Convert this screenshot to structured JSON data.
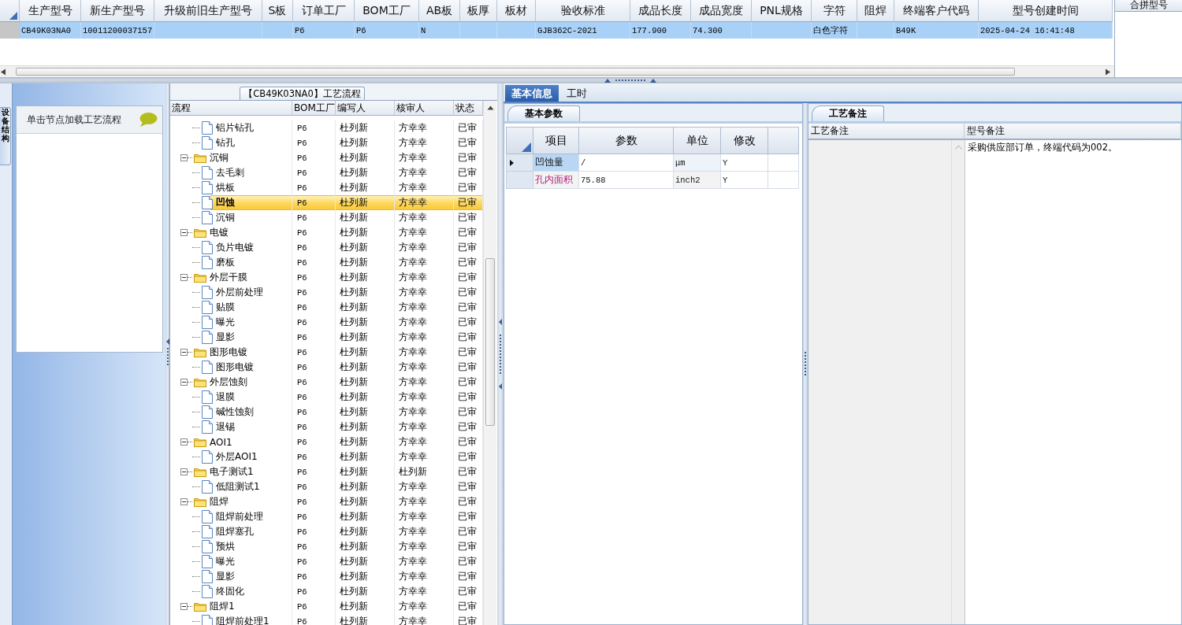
{
  "top_grid": {
    "columns": [
      "生产型号",
      "新生产型号",
      "升级前旧生产型号",
      "S板",
      "订单工厂",
      "BOM工厂",
      "AB板",
      "板厚",
      "板材",
      "验收标准",
      "成品长度",
      "成品宽度",
      "PNL规格",
      "字符",
      "阻焊",
      "终端客户代码",
      "型号创建时间"
    ],
    "rows": [
      {
        "selected": true,
        "cells": [
          "CB49K03NA0",
          "10011200037157",
          null,
          null,
          "P6",
          "P6",
          "N",
          null,
          null,
          "GJB362C-2021",
          "177.900",
          "74.300",
          null,
          "白色字符",
          null,
          "B49K",
          "2025-04-24 16:41:48"
        ]
      }
    ]
  },
  "merge_panel": {
    "title": "合拼型号"
  },
  "side_tab": {
    "label": "设备结构"
  },
  "node_card": {
    "title": "单击节点加载工艺流程"
  },
  "flow_panel": {
    "title": "【CB49K03NA0】工艺流程",
    "columns": [
      "流程",
      "BOM工厂",
      "编写人",
      "核审人",
      "状态"
    ],
    "nodes": [
      {
        "kind": "leaf",
        "name": "铝片钻孔",
        "bom": "P6",
        "writer": "杜列新",
        "reviewer": "方幸幸",
        "status": "已审",
        "selected": false
      },
      {
        "kind": "leaf",
        "name": "钻孔",
        "bom": "P6",
        "writer": "杜列新",
        "reviewer": "方幸幸",
        "status": "已审",
        "selected": false
      },
      {
        "kind": "folder",
        "name": "沉铜",
        "bom": "P6",
        "writer": "杜列新",
        "reviewer": "方幸幸",
        "status": "已审",
        "selected": false,
        "expanded": true,
        "children": [
          {
            "kind": "leaf",
            "name": "去毛刺",
            "bom": "P6",
            "writer": "杜列新",
            "reviewer": "方幸幸",
            "status": "已审",
            "selected": false
          },
          {
            "kind": "leaf",
            "name": "烘板",
            "bom": "P6",
            "writer": "杜列新",
            "reviewer": "方幸幸",
            "status": "已审",
            "selected": false
          },
          {
            "kind": "leaf",
            "name": "凹蚀",
            "bom": "P6",
            "writer": "杜列新",
            "reviewer": "方幸幸",
            "status": "已审",
            "selected": true
          },
          {
            "kind": "leaf",
            "name": "沉铜",
            "bom": "P6",
            "writer": "杜列新",
            "reviewer": "方幸幸",
            "status": "已审",
            "selected": false
          }
        ]
      },
      {
        "kind": "folder",
        "name": "电镀",
        "bom": "P6",
        "writer": "杜列新",
        "reviewer": "方幸幸",
        "status": "已审",
        "selected": false,
        "expanded": true,
        "children": [
          {
            "kind": "leaf",
            "name": "负片电镀",
            "bom": "P6",
            "writer": "杜列新",
            "reviewer": "方幸幸",
            "status": "已审",
            "selected": false
          },
          {
            "kind": "leaf",
            "name": "磨板",
            "bom": "P6",
            "writer": "杜列新",
            "reviewer": "方幸幸",
            "status": "已审",
            "selected": false
          }
        ]
      },
      {
        "kind": "folder",
        "name": "外层干膜",
        "bom": "P6",
        "writer": "杜列新",
        "reviewer": "方幸幸",
        "status": "已审",
        "selected": false,
        "expanded": true,
        "children": [
          {
            "kind": "leaf",
            "name": "外层前处理",
            "bom": "P6",
            "writer": "杜列新",
            "reviewer": "方幸幸",
            "status": "已审",
            "selected": false
          },
          {
            "kind": "leaf",
            "name": "贴膜",
            "bom": "P6",
            "writer": "杜列新",
            "reviewer": "方幸幸",
            "status": "已审",
            "selected": false
          },
          {
            "kind": "leaf",
            "name": "曝光",
            "bom": "P6",
            "writer": "杜列新",
            "reviewer": "方幸幸",
            "status": "已审",
            "selected": false
          },
          {
            "kind": "leaf",
            "name": "显影",
            "bom": "P6",
            "writer": "杜列新",
            "reviewer": "方幸幸",
            "status": "已审",
            "selected": false
          }
        ]
      },
      {
        "kind": "folder",
        "name": "图形电镀",
        "bom": "P6",
        "writer": "杜列新",
        "reviewer": "方幸幸",
        "status": "已审",
        "selected": false,
        "expanded": true,
        "children": [
          {
            "kind": "leaf",
            "name": "图形电镀",
            "bom": "P6",
            "writer": "杜列新",
            "reviewer": "方幸幸",
            "status": "已审",
            "selected": false
          }
        ]
      },
      {
        "kind": "folder",
        "name": "外层蚀刻",
        "bom": "P6",
        "writer": "杜列新",
        "reviewer": "方幸幸",
        "status": "已审",
        "selected": false,
        "expanded": true,
        "children": [
          {
            "kind": "leaf",
            "name": "退膜",
            "bom": "P6",
            "writer": "杜列新",
            "reviewer": "方幸幸",
            "status": "已审",
            "selected": false
          },
          {
            "kind": "leaf",
            "name": "碱性蚀刻",
            "bom": "P6",
            "writer": "杜列新",
            "reviewer": "方幸幸",
            "status": "已审",
            "selected": false
          },
          {
            "kind": "leaf",
            "name": "退锡",
            "bom": "P6",
            "writer": "杜列新",
            "reviewer": "方幸幸",
            "status": "已审",
            "selected": false
          }
        ]
      },
      {
        "kind": "folder",
        "name": "AOI1",
        "bom": "P6",
        "writer": "杜列新",
        "reviewer": "方幸幸",
        "status": "已审",
        "selected": false,
        "expanded": true,
        "children": [
          {
            "kind": "leaf",
            "name": "外层AOI1",
            "bom": "P6",
            "writer": "杜列新",
            "reviewer": "方幸幸",
            "status": "已审",
            "selected": false
          }
        ]
      },
      {
        "kind": "folder",
        "name": "电子测试1",
        "bom": "P6",
        "writer": "杜列新",
        "reviewer": "杜列新",
        "status": "已审",
        "selected": false,
        "expanded": true,
        "children": [
          {
            "kind": "leaf",
            "name": "低阻测试1",
            "bom": "P6",
            "writer": "杜列新",
            "reviewer": "方幸幸",
            "status": "已审",
            "selected": false
          }
        ]
      },
      {
        "kind": "folder",
        "name": "阻焊",
        "bom": "P6",
        "writer": "杜列新",
        "reviewer": "方幸幸",
        "status": "已审",
        "selected": false,
        "expanded": true,
        "children": [
          {
            "kind": "leaf",
            "name": "阻焊前处理",
            "bom": "P6",
            "writer": "杜列新",
            "reviewer": "方幸幸",
            "status": "已审",
            "selected": false
          },
          {
            "kind": "leaf",
            "name": "阻焊塞孔",
            "bom": "P6",
            "writer": "杜列新",
            "reviewer": "方幸幸",
            "status": "已审",
            "selected": false
          },
          {
            "kind": "leaf",
            "name": "预烘",
            "bom": "P6",
            "writer": "杜列新",
            "reviewer": "方幸幸",
            "status": "已审",
            "selected": false
          },
          {
            "kind": "leaf",
            "name": "曝光",
            "bom": "P6",
            "writer": "杜列新",
            "reviewer": "方幸幸",
            "status": "已审",
            "selected": false
          },
          {
            "kind": "leaf",
            "name": "显影",
            "bom": "P6",
            "writer": "杜列新",
            "reviewer": "方幸幸",
            "status": "已审",
            "selected": false
          },
          {
            "kind": "leaf",
            "name": "终固化",
            "bom": "P6",
            "writer": "杜列新",
            "reviewer": "方幸幸",
            "status": "已审",
            "selected": false
          }
        ]
      },
      {
        "kind": "folder",
        "name": "阻焊1",
        "bom": "P6",
        "writer": "杜列新",
        "reviewer": "方幸幸",
        "status": "已审",
        "selected": false,
        "expanded": true,
        "children": [
          {
            "kind": "leaf",
            "name": "阻焊前处理1",
            "bom": "P6",
            "writer": "杜列新",
            "reviewer": "方幸幸",
            "status": "已审",
            "selected": false
          }
        ]
      }
    ]
  },
  "info_tabs": [
    {
      "label": "基本信息",
      "selected": true
    },
    {
      "label": "工时",
      "selected": false
    }
  ],
  "params_panel": {
    "tab": "基本参数",
    "columns": [
      "项目",
      "参数",
      "单位",
      "修改"
    ],
    "rows": [
      {
        "selected": true,
        "highlighted": false,
        "item": "凹蚀量",
        "value": "/",
        "unit": "μm",
        "modified": "Y"
      },
      {
        "selected": false,
        "highlighted": true,
        "item": "孔内面积",
        "value": "75.88",
        "unit": "inch2",
        "modified": "Y"
      }
    ]
  },
  "notes_panel": {
    "tab": "工艺备注",
    "columns": [
      "工艺备注",
      "型号备注"
    ],
    "model_note": "采购供应部订单，终端代码为002。"
  }
}
